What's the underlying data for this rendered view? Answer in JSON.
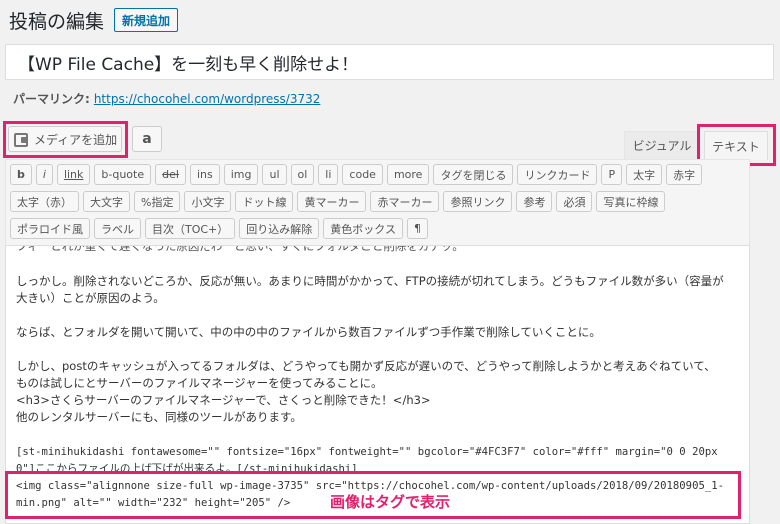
{
  "header": {
    "page_title": "投稿の編集",
    "add_new_label": "新規追加"
  },
  "post": {
    "title": "【WP File Cache】を一刻も早く削除せよ！",
    "permalink_label": "パーマリンク:",
    "permalink_url": "https://chocohel.com/wordpress/3732"
  },
  "media": {
    "add_media_label": "メディアを追加",
    "amazon_label": "a"
  },
  "tabs": {
    "visual": "ビジュアル",
    "text": "テキスト"
  },
  "quicktags": {
    "row1": [
      "b",
      "i",
      "link",
      "b-quote",
      "del",
      "ins",
      "img",
      "ul",
      "ol",
      "li",
      "code",
      "more",
      "タグを閉じる",
      "リンクカード",
      "P",
      "太字",
      "赤字"
    ],
    "row2": [
      "太字（赤）",
      "大文字",
      "%指定",
      "小文字",
      "ドット線",
      "黄マーカー",
      "赤マーカー",
      "参照リンク",
      "参考",
      "必須",
      "写真に枠線"
    ],
    "row3": [
      "ポラロイド風",
      "ラベル",
      "目次（TOC+）",
      "回り込み解除",
      "黄色ボックス",
      "¶"
    ]
  },
  "editor": {
    "line_cut": "フィーとれが重くて遅くなった原因だわーと思い、すぐにフォルダごと削除をカチッ。",
    "line1": "しっかし。削除されないどころか、反応が無い。あまりに時間がかかって、FTPの接続が切れてしまう。どうもファイル数が多い（容量が",
    "line2": "大きい）ことが原因のよう。",
    "line3": "ならば、とフォルダを開いて開いて、中の中の中のファイルから数百ファイルずつ手作業で削除していくことに。",
    "line4": "しかし、postのキャッシュが入ってるフォルダは、どうやっても開かず反応が遅いので、どうやって削除しようかと考えあぐねていて、",
    "line5": "ものは試しにとサーバーのファイルマネージャーを使ってみることに。",
    "line6": "<h3>さくらサーバーのファイルマネージャーで、さくっと削除できた！</h3>",
    "line7": "他のレンタルサーバーにも、同様のツールがあります。",
    "line8": "[st-minihukidashi fontawesome=\"\" fontsize=\"16px\" fontweight=\"\" bgcolor=\"#4FC3F7\" color=\"#fff\" margin=\"0 0 20px",
    "line9": "0\"]ここからファイルの上げ下げが出来るよ。[/st-minihukidashi]",
    "line10": "<img class=\"alignnone size-full wp-image-3735\" src=\"https://chocohel.com/wp-content/uploads/2018/09/20180905_1-",
    "line11": "min.png\" alt=\"\" width=\"232\" height=\"205\" />"
  },
  "annotation": {
    "callout": "画像はタグで表示"
  },
  "colors": {
    "highlight": "#e0216d",
    "link": "#0073aa"
  }
}
